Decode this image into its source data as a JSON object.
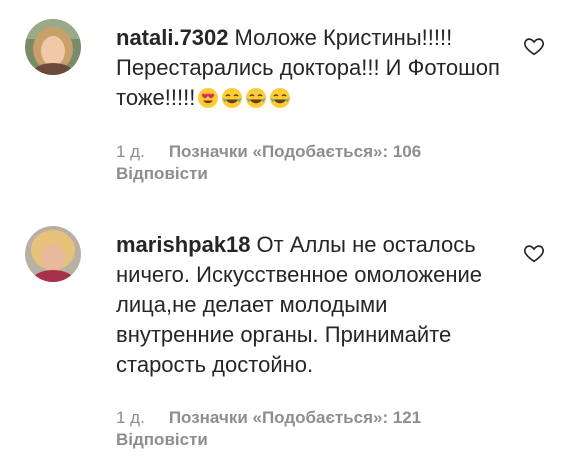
{
  "comments": [
    {
      "username": "natali.7302",
      "text": "Моложе Кристины!!!!! Перестарались доктора!!! И Фотошоп тоже!!!!!",
      "emojis": [
        "heart-eyes-emoji",
        "tears-of-joy-emoji",
        "tears-of-joy-emoji",
        "tears-of-joy-emoji"
      ],
      "age": "1 д.",
      "likes_label": "Позначки «Подобається»: 106",
      "reply_label": "Відповісти"
    },
    {
      "username": "marishpak18",
      "text": "От Аллы не осталось ничего. Искусственное омоложение лица,не делает молодыми внутренние органы. Принимайте старость достойно.",
      "emojis": [],
      "age": "1 д.",
      "likes_label": "Позначки «Подобається»: 121",
      "reply_label": "Відповісти"
    }
  ],
  "colors": {
    "text": "#262626",
    "secondary": "#8e8e8e",
    "emoji_face": "#ffcc33",
    "emoji_tears": "#4aa3df",
    "emoji_heart": "#e0245e"
  }
}
